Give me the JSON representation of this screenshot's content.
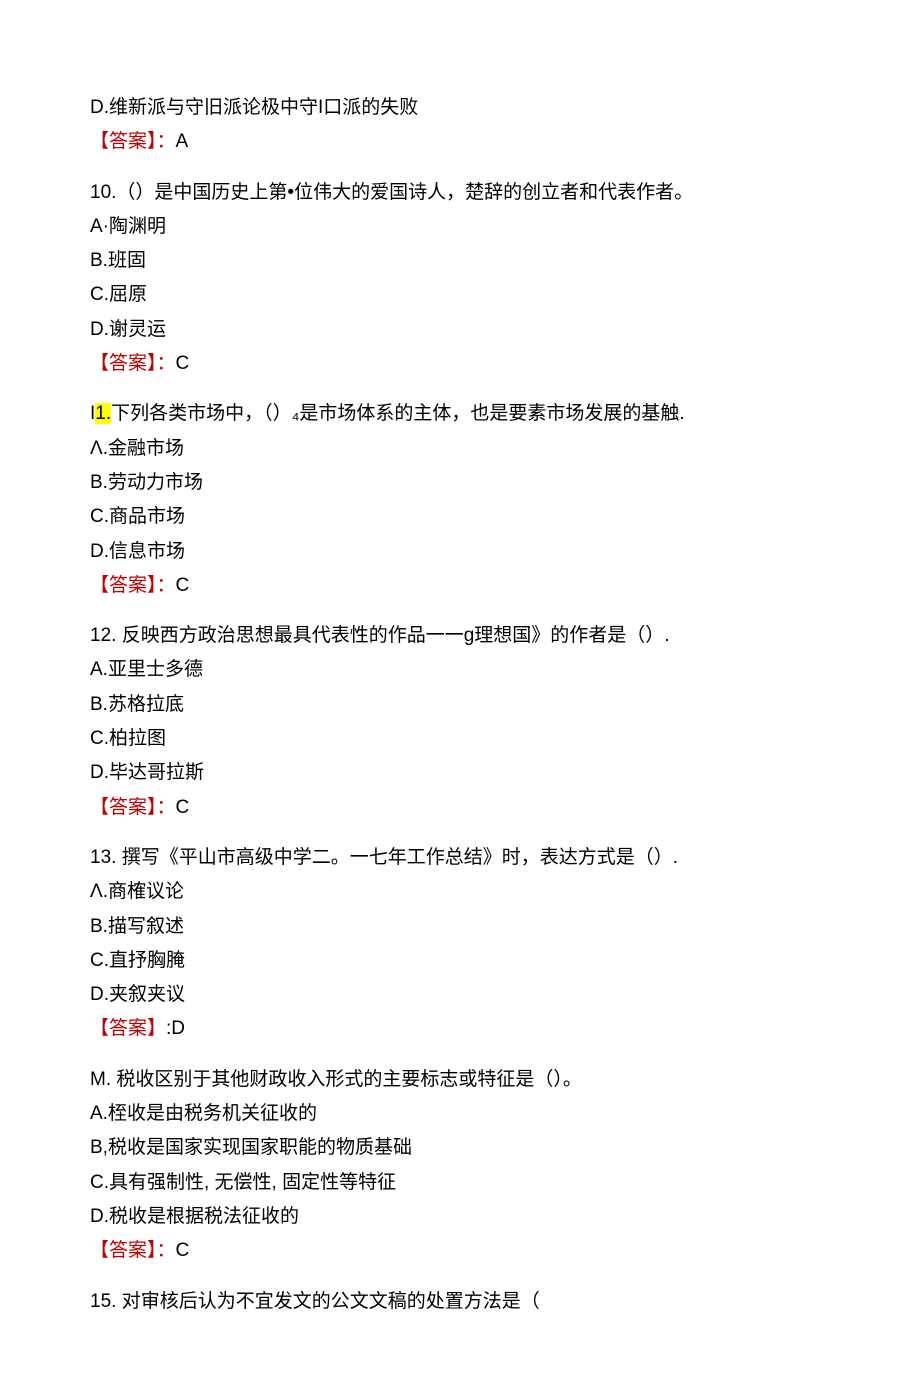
{
  "q9_fragment": {
    "option_d": "D.维新派与守旧派论极中守I口派的失败",
    "answer_label": "【答案】：",
    "answer_value": "A"
  },
  "questions": [
    {
      "number": "10.",
      "stem": "（）是中国历史上第•位伟大的爱国诗人，楚辞的创立者和代表作者。",
      "options": [
        "A·陶渊明",
        "B.班固",
        "C.屈原",
        "D.谢灵运"
      ],
      "answer_label": "【答案】：",
      "answer_value": "C"
    },
    {
      "number_prefix": "I",
      "number_highlight": "1.",
      "stem": "下列各类市场中，（）₄是市场体系的主体，也是要素市场发展的基触.",
      "options": [
        "Λ.金融市场",
        "B.劳动力市场",
        "C.商品市场",
        "D.信息市场"
      ],
      "answer_label": "【答案】：",
      "answer_value": "C"
    },
    {
      "number": "12.",
      "stem": " 反映西方政治思想最具代表性的作品一一g理想国》的作者是（）.",
      "options": [
        "A.亚里士多德",
        "B.苏格拉底",
        "C.柏拉图",
        "D.毕达哥拉斯"
      ],
      "answer_label": "【答案】：",
      "answer_value": "C"
    },
    {
      "number": "13.",
      "stem": " 撰写《平山市高级中学二。一七年工作总结》时，表达方式是（）.",
      "options": [
        "Λ.商榷议论",
        "B.描写叙述",
        "C.直抒胸腌",
        "D.夹叙夹议"
      ],
      "answer_label": "【答案】",
      "answer_value": ":D"
    },
    {
      "number": "M.",
      "stem": " 税收区别于其他财政收入形式的主要标志或特征是（）。",
      "options": [
        "A.桎收是由税务机关征收的",
        "B,税收是国家实现国家职能的物质基础",
        "C.具有强制性, 无偿性, 固定性等特征",
        "D.税收是根据税法征收的"
      ],
      "answer_label": "【答案】：",
      "answer_value": "C"
    },
    {
      "number": "15.",
      "stem": " 对审核后认为不宜发文的公文文稿的处置方法是（"
    }
  ]
}
